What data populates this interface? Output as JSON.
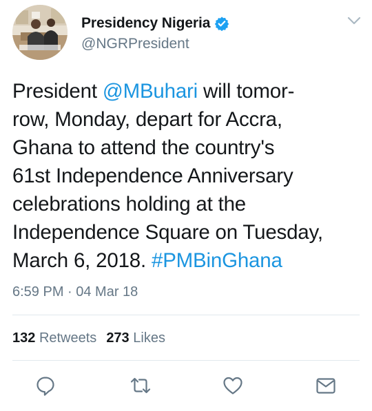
{
  "author": {
    "display_name": "Presidency Nigeria",
    "handle": "@NGRPresident",
    "verified": true,
    "verified_icon": "verified-badge-icon"
  },
  "tweet": {
    "lines": [
      [
        {
          "text": "President "
        },
        {
          "text": "@MBuhari",
          "link": true
        },
        {
          "text": " will tomor-"
        }
      ],
      [
        {
          "text": "row, Monday, depart for Accra,"
        }
      ],
      [
        {
          "text": "Ghana to attend the country's"
        }
      ],
      [
        {
          "text": "61st Independence Anniversary"
        }
      ],
      [
        {
          "text": "celebrations holding at the"
        }
      ],
      [
        {
          "text": "Independence Square on Tuesday,"
        }
      ],
      [
        {
          "text": "March 6, 2018. "
        },
        {
          "text": "#PMBinGhana",
          "link": true
        }
      ]
    ],
    "timestamp": "6:59 PM · 04 Mar 18"
  },
  "stats": {
    "retweets_count": "132",
    "retweets_label": "Retweets",
    "likes_count": "273",
    "likes_label": "Likes"
  },
  "actions": [
    "reply-icon",
    "retweet-icon",
    "like-icon",
    "message-icon"
  ],
  "colors": {
    "link": "#1b95e0",
    "secondary_text": "#657786",
    "primary_text": "#14171a",
    "divider": "#e1e8ed",
    "verified": "#1da1f2"
  }
}
